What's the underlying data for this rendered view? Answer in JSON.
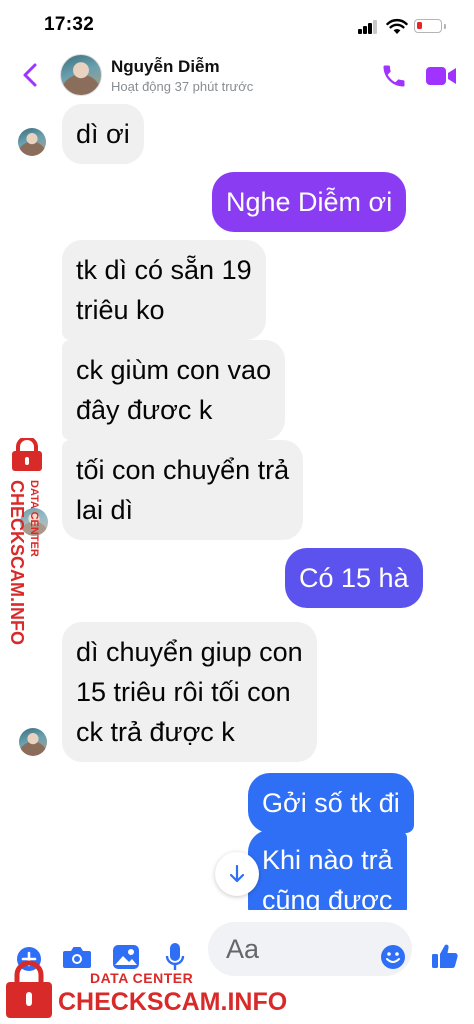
{
  "status_bar": {
    "time": "17:32",
    "battery_level": 0.12
  },
  "header": {
    "contact_name": "Nguyễn Diễm",
    "contact_status": "Hoạt động 37 phút trước"
  },
  "messages": [
    {
      "sender": "contact",
      "text": "dì ơi"
    },
    {
      "sender": "me",
      "text": "Nghe Diễm ơi"
    },
    {
      "sender": "contact",
      "lines": [
        "tk dì có sẵn 19",
        "triêu ko"
      ]
    },
    {
      "sender": "contact",
      "lines": [
        "ck giùm con vao",
        "đây đươc k"
      ]
    },
    {
      "sender": "contact",
      "lines": [
        "tối con chuyển trả",
        "lai dì"
      ]
    },
    {
      "sender": "me",
      "text": "Có 15 hà"
    },
    {
      "sender": "contact",
      "lines": [
        "dì chuyển giup con",
        "15 triêu rôi tối con",
        "ck trả được k"
      ]
    },
    {
      "sender": "me",
      "text": "Gởi số tk đi"
    },
    {
      "sender": "me",
      "lines": [
        "Khi nào trả",
        "cũng được"
      ]
    }
  ],
  "composer": {
    "placeholder": "Aa"
  },
  "watermark": {
    "line1": "DATA CENTER",
    "line2": "CHECKSCAM.INFO"
  },
  "colors": {
    "accent": "#a033ff",
    "bubble_purple": "#8a3cf2",
    "bubble_indigo": "#5c52ee",
    "bubble_blue": "#2f6ff5",
    "incoming_bubble": "#f0f0f0",
    "watermark_red": "#d92a2a"
  }
}
